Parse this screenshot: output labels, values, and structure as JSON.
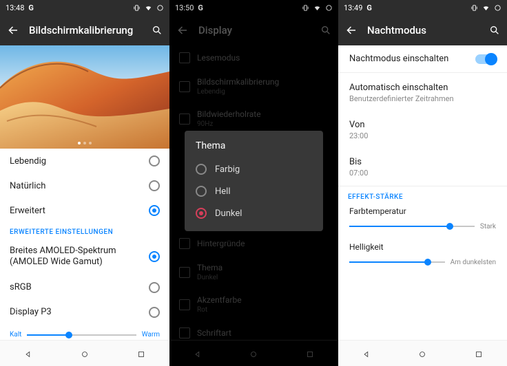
{
  "screen1": {
    "status": {
      "time": "13:48",
      "g": "G"
    },
    "appbar": {
      "title": "Bildschirmkalibrierung"
    },
    "options": [
      {
        "label": "Lebendig",
        "checked": false
      },
      {
        "label": "Natürlich",
        "checked": false
      },
      {
        "label": "Erweitert",
        "checked": true
      }
    ],
    "section": "ERWEITERTE EINSTELLUNGEN",
    "adv_options": [
      {
        "label": "Breites AMOLED-Spektrum (AMOLED Wide Gamut)",
        "checked": true
      },
      {
        "label": "sRGB",
        "checked": false
      },
      {
        "label": "Display P3",
        "checked": false
      }
    ],
    "slider": {
      "left": "Kalt",
      "right": "Warm",
      "pct": 38
    }
  },
  "screen2": {
    "status": {
      "time": "13:50",
      "g": "G"
    },
    "appbar": {
      "title": "Display"
    },
    "items": [
      {
        "label": "Lesemodus",
        "sub": ""
      },
      {
        "label": "Bildschirmkalibrierung",
        "sub": "Lebendig"
      },
      {
        "label": "Bildwiederholrate",
        "sub": "90Hz"
      }
    ],
    "items2": [
      {
        "label": "Hintergründe",
        "sub": ""
      },
      {
        "label": "Thema",
        "sub": "Dunkel"
      },
      {
        "label": "Akzentfarbe",
        "sub": "Rot"
      },
      {
        "label": "Schriftart",
        "sub": ""
      }
    ],
    "dialog": {
      "title": "Thema",
      "options": [
        {
          "label": "Farbig",
          "sel": false
        },
        {
          "label": "Hell",
          "sel": false
        },
        {
          "label": "Dunkel",
          "sel": true
        }
      ]
    }
  },
  "screen3": {
    "status": {
      "time": "13:49",
      "g": "G"
    },
    "appbar": {
      "title": "Nachtmodus"
    },
    "toggle": {
      "label": "Nachtmodus einschalten"
    },
    "auto": {
      "label": "Automatisch einschalten",
      "sub": "Benutzerdefinierter Zeitrahmen"
    },
    "from": {
      "label": "Von",
      "value": "23:00"
    },
    "to": {
      "label": "Bis",
      "value": "07:00"
    },
    "section": "EFFEKT-STÄRKE",
    "slider1": {
      "label": "Farbtemperatur",
      "end": "Stark",
      "pct": 80
    },
    "slider2": {
      "label": "Helligkeit",
      "end": "Am dunkelsten",
      "pct": 82
    }
  }
}
